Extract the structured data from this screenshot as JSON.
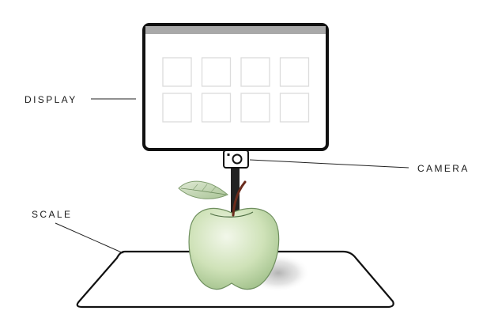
{
  "labels": {
    "display": "DISPLAY",
    "camera": "CAMERA",
    "scale": "SCALE"
  },
  "display_screen": {
    "tile_rows": 2,
    "tile_columns": 4
  },
  "colors": {
    "outline": "#111111",
    "screen_bar": "#a9a9a9",
    "tile_border": "#dcdcdc",
    "apple_light": "#eef5e4",
    "apple_mid": "#c9dfb0",
    "apple_dark": "#8fb27a",
    "leaf": "#b8cfa8",
    "stem": "#6a2b1c",
    "pole": "#222222"
  }
}
